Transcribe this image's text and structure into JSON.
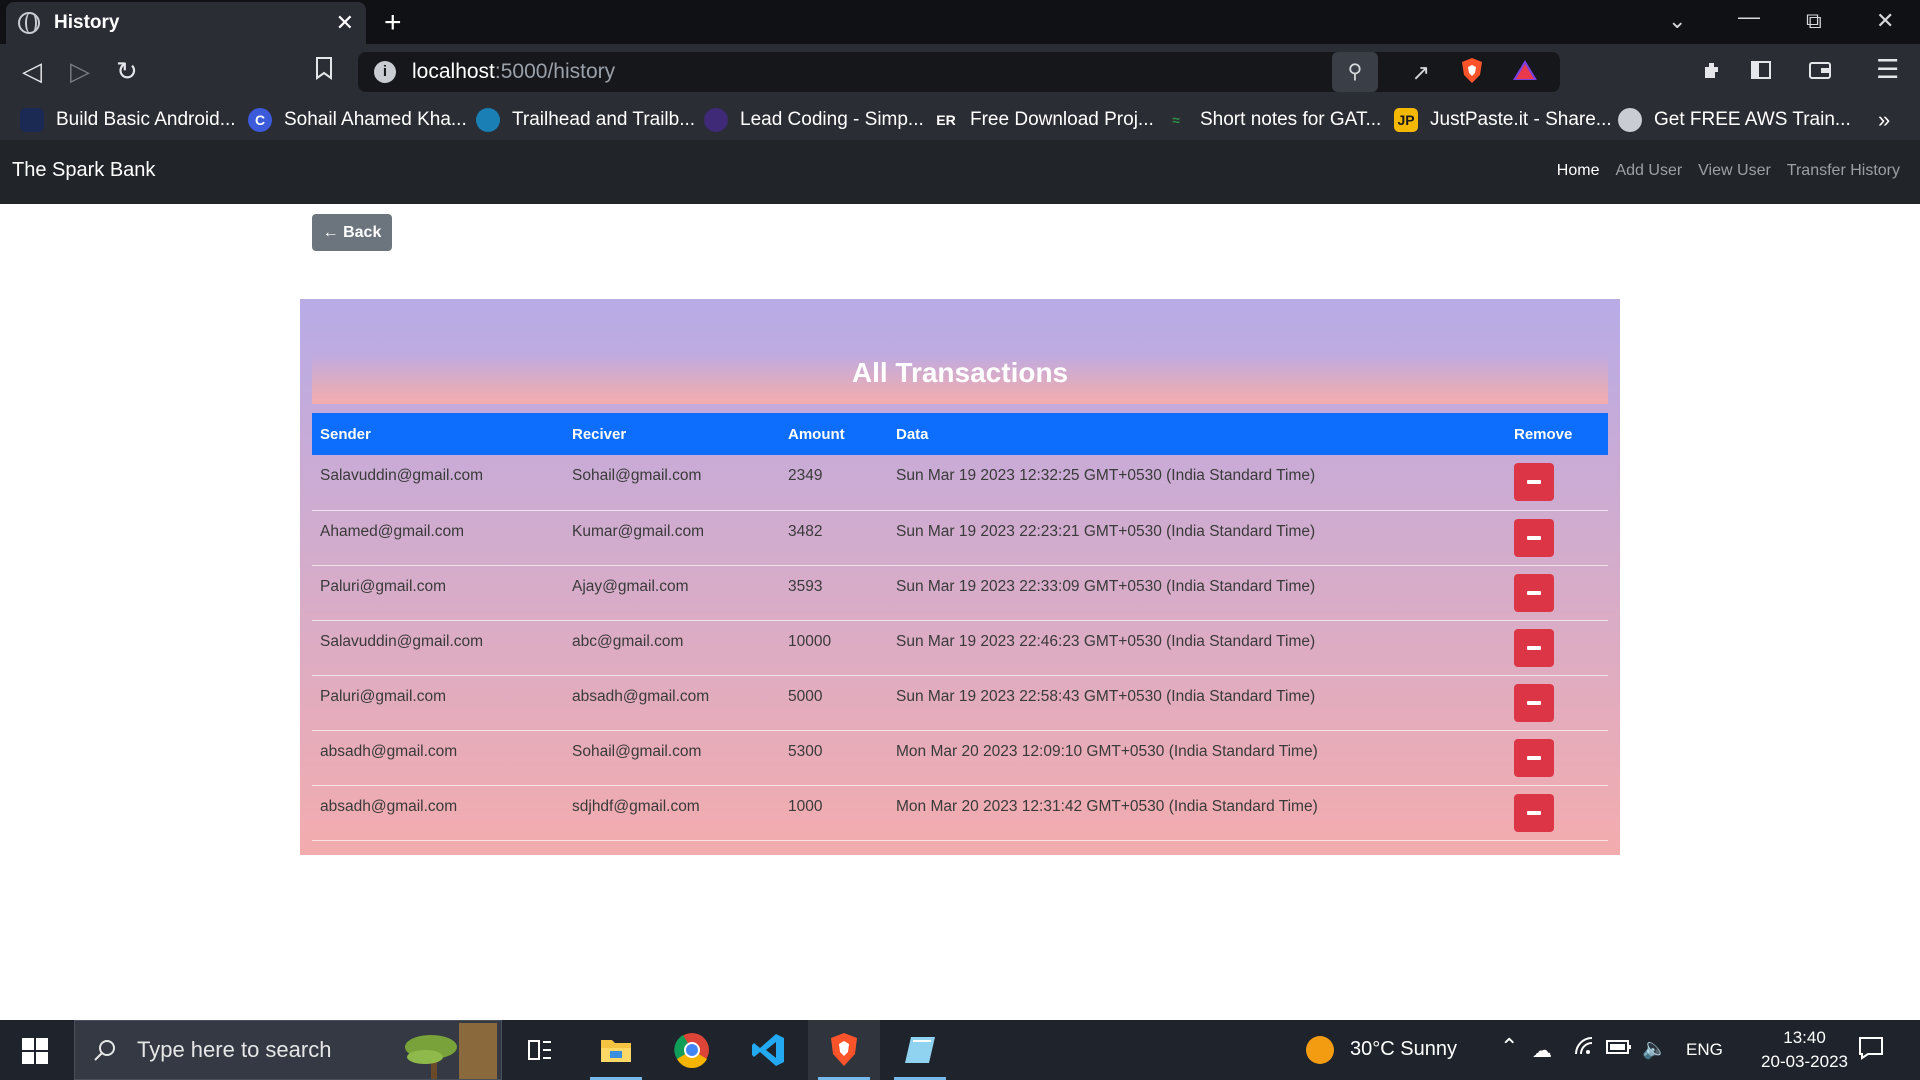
{
  "browser": {
    "tab_title": "History",
    "tab_close": "✕",
    "new_tab": "+",
    "url_host": "localhost",
    "url_path": ":5000/history",
    "bookmarks": [
      {
        "label": "Build Basic Android...",
        "icon": "android-course-icon"
      },
      {
        "label": "Sohail Ahamed Kha...",
        "icon": "c-logo-icon"
      },
      {
        "label": "Trailhead and Trailb...",
        "icon": "trailhead-icon"
      },
      {
        "label": "Lead Coding - Simp...",
        "icon": "lead-coding-icon"
      },
      {
        "label": "Free Download Proj...",
        "icon": "er-icon"
      },
      {
        "label": "Short notes for GAT...",
        "icon": "gfg-icon"
      },
      {
        "label": "JustPaste.it - Share...",
        "icon": "jp-icon"
      },
      {
        "label": "Get FREE AWS Train...",
        "icon": "globe-icon"
      }
    ],
    "bookmarks_more": "»"
  },
  "site": {
    "brand": "The Spark Bank",
    "nav": [
      "Home",
      "Add User",
      "View User",
      "Transfer History"
    ],
    "back_label": "← Back",
    "heading": "All Transactions",
    "columns": [
      "Sender",
      "Reciver",
      "Amount",
      "Data",
      "Remove"
    ],
    "rows": [
      {
        "sender": "Salavuddin@gmail.com",
        "receiver": "Sohail@gmail.com",
        "amount": "2349",
        "date": "Sun Mar 19 2023 12:32:25 GMT+0530 (India Standard Time)"
      },
      {
        "sender": "Ahamed@gmail.com",
        "receiver": "Kumar@gmail.com",
        "amount": "3482",
        "date": "Sun Mar 19 2023 22:23:21 GMT+0530 (India Standard Time)"
      },
      {
        "sender": "Paluri@gmail.com",
        "receiver": "Ajay@gmail.com",
        "amount": "3593",
        "date": "Sun Mar 19 2023 22:33:09 GMT+0530 (India Standard Time)"
      },
      {
        "sender": "Salavuddin@gmail.com",
        "receiver": "abc@gmail.com",
        "amount": "10000",
        "date": "Sun Mar 19 2023 22:46:23 GMT+0530 (India Standard Time)"
      },
      {
        "sender": "Paluri@gmail.com",
        "receiver": "absadh@gmail.com",
        "amount": "5000",
        "date": "Sun Mar 19 2023 22:58:43 GMT+0530 (India Standard Time)"
      },
      {
        "sender": "absadh@gmail.com",
        "receiver": "Sohail@gmail.com",
        "amount": "5300",
        "date": "Mon Mar 20 2023 12:09:10 GMT+0530 (India Standard Time)"
      },
      {
        "sender": "absadh@gmail.com",
        "receiver": "sdjhdf@gmail.com",
        "amount": "1000",
        "date": "Mon Mar 20 2023 12:31:42 GMT+0530 (India Standard Time)"
      }
    ]
  },
  "taskbar": {
    "search_placeholder": "Type here to search",
    "weather": "30°C  Sunny",
    "language": "ENG",
    "time": "13:40",
    "date": "20-03-2023"
  },
  "colors": {
    "navbar": "#212529",
    "table_header": "#0d6efd",
    "remove_button": "#dc3545",
    "back_button": "#6c757d",
    "gradient_top": "#b8abe6",
    "gradient_bottom": "#f3acae"
  }
}
